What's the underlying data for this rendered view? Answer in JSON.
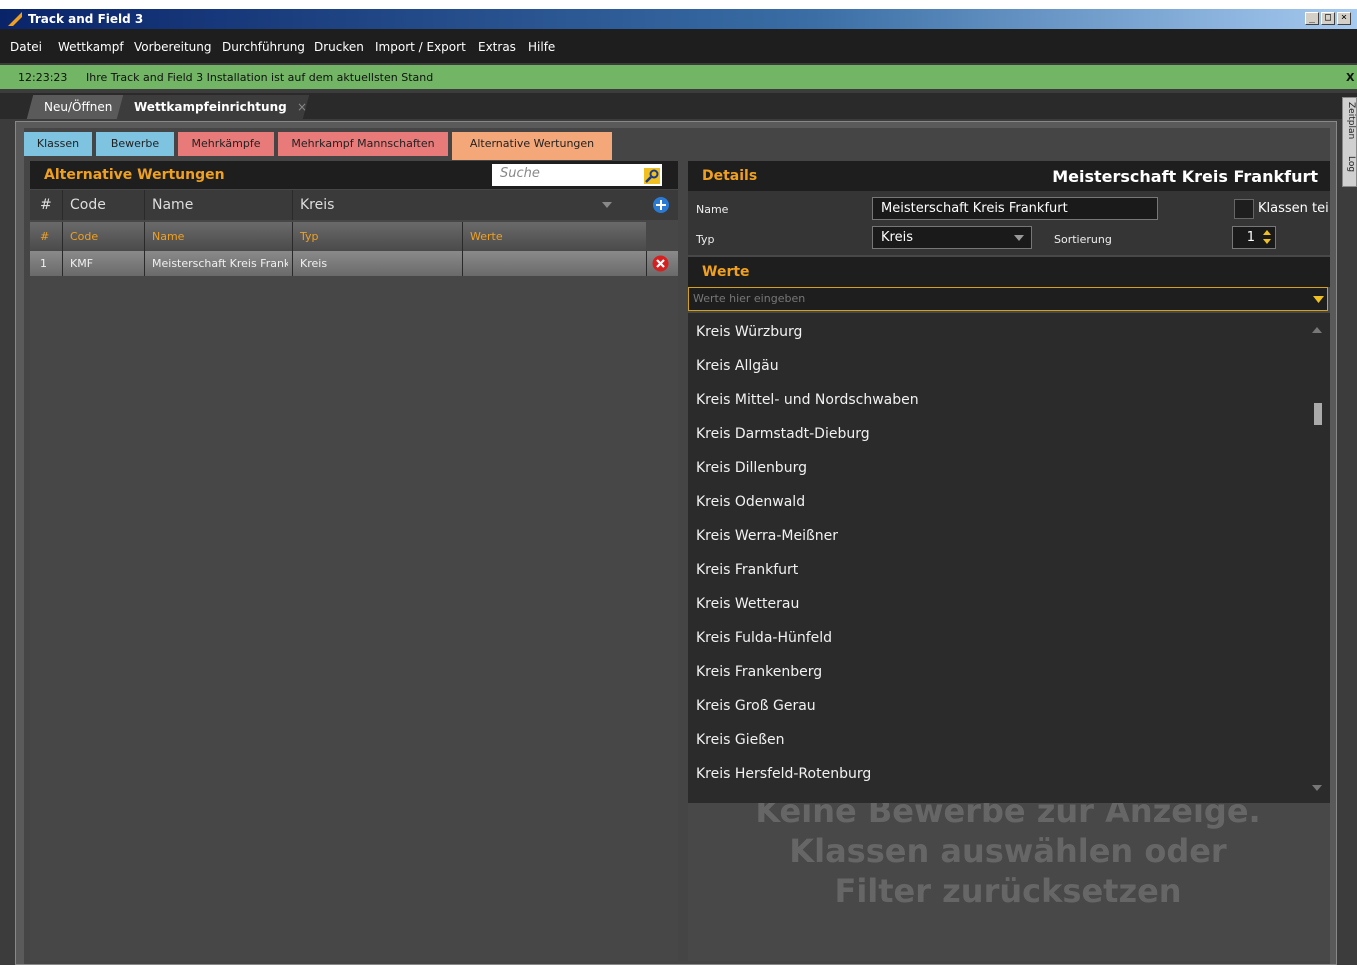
{
  "window": {
    "title": "Track and Field 3",
    "controls": [
      "_",
      "□",
      "×"
    ]
  },
  "menu": [
    "Datei",
    "Wettkampf",
    "Vorbereitung",
    "Durchführung",
    "Drucken",
    "Import / Export",
    "Extras",
    "Hilfe"
  ],
  "infobar": {
    "time": "12:23:23",
    "message": "Ihre Track and Field 3 Installation ist auf dem aktuellsten Stand",
    "close": "X"
  },
  "main_tabs": [
    {
      "label": "Neu/Öffnen"
    },
    {
      "label": "Wettkampfeinrichtung",
      "close": "×"
    }
  ],
  "side_tabs": [
    "Zeitplan",
    "Log"
  ],
  "sub_tabs": [
    {
      "label": "Klassen",
      "color": "#7ec3e0"
    },
    {
      "label": "Bewerbe",
      "color": "#7ec3e0"
    },
    {
      "label": "Mehrkämpfe",
      "color": "#e87a7a"
    },
    {
      "label": "Mehrkampf Mannschaften",
      "color": "#e87a7a"
    },
    {
      "label": "Alternative Wertungen",
      "color": "#f4a87a"
    }
  ],
  "left_panel": {
    "title": "Alternative Wertungen",
    "search_placeholder": "Suche",
    "filter": {
      "num": "#",
      "code": "Code",
      "name": "Name",
      "type": "Kreis"
    },
    "columns": {
      "num": "#",
      "code": "Code",
      "name": "Name",
      "type": "Typ",
      "values": "Werte"
    },
    "rows": [
      {
        "num": "1",
        "code": "KMF",
        "name": "Meisterschaft Kreis Frankfurt",
        "type": "Kreis",
        "values": ""
      }
    ]
  },
  "details": {
    "title": "Details",
    "heading": "Meisterschaft Kreis Frankfurt",
    "name_label": "Name",
    "name_value": "Meisterschaft Kreis Frankfurt",
    "type_label": "Typ",
    "type_value": "Kreis",
    "sort_label": "Sortierung",
    "sort_value": "1",
    "checkbox_label": "Klassen tei"
  },
  "werte": {
    "title": "Werte",
    "placeholder": "Werte hier eingeben",
    "items": [
      "Kreis Würzburg",
      "Kreis Allgäu",
      "Kreis Mittel- und Nordschwaben",
      "Kreis Darmstadt-Dieburg",
      "Kreis Dillenburg",
      "Kreis Odenwald",
      "Kreis Werra-Meißner",
      "Kreis Frankfurt",
      "Kreis Wetterau",
      "Kreis Fulda-Hünfeld",
      "Kreis Frankenberg",
      "Kreis Groß Gerau",
      "Kreis Gießen",
      "Kreis Hersfeld-Rotenburg"
    ]
  },
  "empty_message": [
    "Keine Bewerbe zur Anzeige.",
    "Klassen auswählen oder",
    "Filter zurücksetzen"
  ],
  "colors": {
    "accent": "#f0a020",
    "info": "#72b565"
  }
}
